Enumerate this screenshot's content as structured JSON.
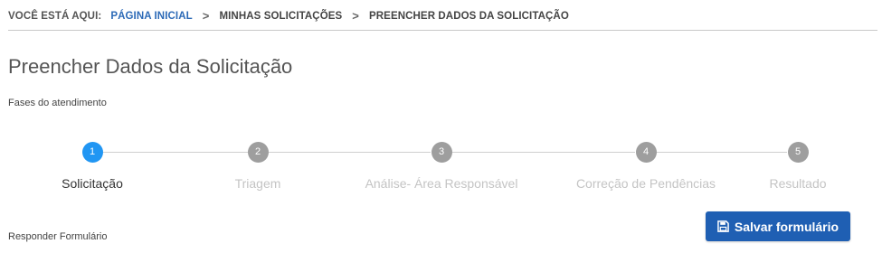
{
  "breadcrumb": {
    "prefix": "VOCÊ ESTÁ AQUI:",
    "items": [
      "PÁGINA INICIAL",
      "MINHAS SOLICITAÇÕES",
      "PREENCHER DADOS DA SOLICITAÇÃO"
    ],
    "separator": ">"
  },
  "page": {
    "title": "Preencher Dados da Solicitação",
    "phases_label": "Fases do atendimento",
    "respond_label": "Responder Formulário"
  },
  "stepper": {
    "active_index": 0,
    "steps": [
      {
        "number": "1",
        "label": "Solicitação"
      },
      {
        "number": "2",
        "label": "Triagem"
      },
      {
        "number": "3",
        "label": "Análise- Área Responsável"
      },
      {
        "number": "4",
        "label": "Correção de Pendências"
      },
      {
        "number": "5",
        "label": "Resultado"
      }
    ]
  },
  "actions": {
    "save_label": "Salvar formulário",
    "save_icon": "floppy-disk-icon"
  },
  "colors": {
    "accent": "#2196f3",
    "button": "#1f5fb3",
    "link": "#2c6ab7",
    "inactive_step": "#9e9e9e"
  }
}
